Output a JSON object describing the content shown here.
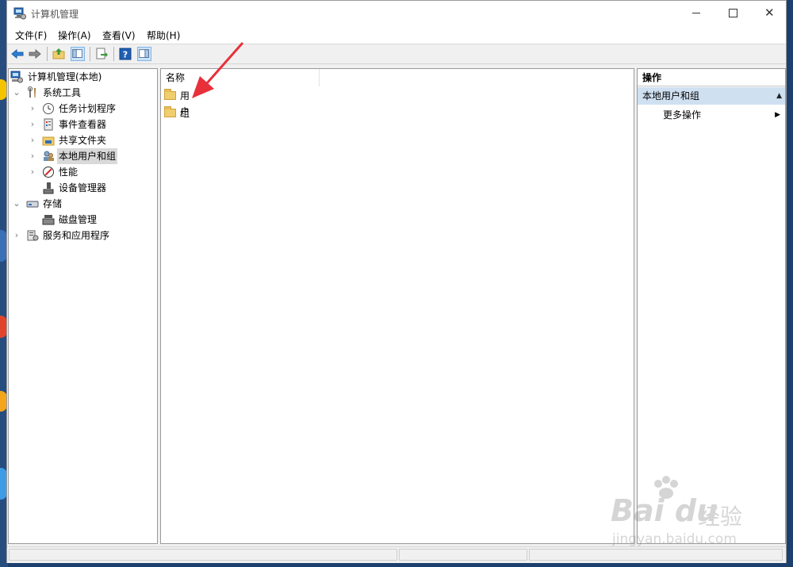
{
  "window": {
    "title": "计算机管理",
    "controls": {
      "minimize": "minimize-icon",
      "maximize": "maximize-icon",
      "close": "close-icon"
    }
  },
  "menu": [
    "文件(F)",
    "操作(A)",
    "查看(V)",
    "帮助(H)"
  ],
  "toolbar": {
    "icons": [
      "back-arrow-icon",
      "forward-arrow-icon",
      "up-folder-icon",
      "show-hide-tree-icon",
      "export-list-icon",
      "help-icon",
      "show-hide-action-pane-icon"
    ]
  },
  "tree": {
    "root": "计算机管理(本地)",
    "system_tools": "系统工具",
    "task_scheduler": "任务计划程序",
    "event_viewer": "事件查看器",
    "shared_folders": "共享文件夹",
    "local_users_groups": "本地用户和组",
    "performance": "性能",
    "device_manager": "设备管理器",
    "storage": "存储",
    "disk_management": "磁盘管理",
    "services_apps": "服务和应用程序"
  },
  "list": {
    "column_name": "名称",
    "items": [
      "用户",
      "组"
    ]
  },
  "actions": {
    "header": "操作",
    "section": "本地用户和组",
    "more": "更多操作"
  },
  "colors": {
    "accent_red": "#e8303a",
    "selection": "#cfe0f1",
    "folder": "#f0cd6d"
  },
  "watermark": {
    "logo": "Bai du",
    "label": "经验",
    "url": "jingyan.baidu.com"
  }
}
